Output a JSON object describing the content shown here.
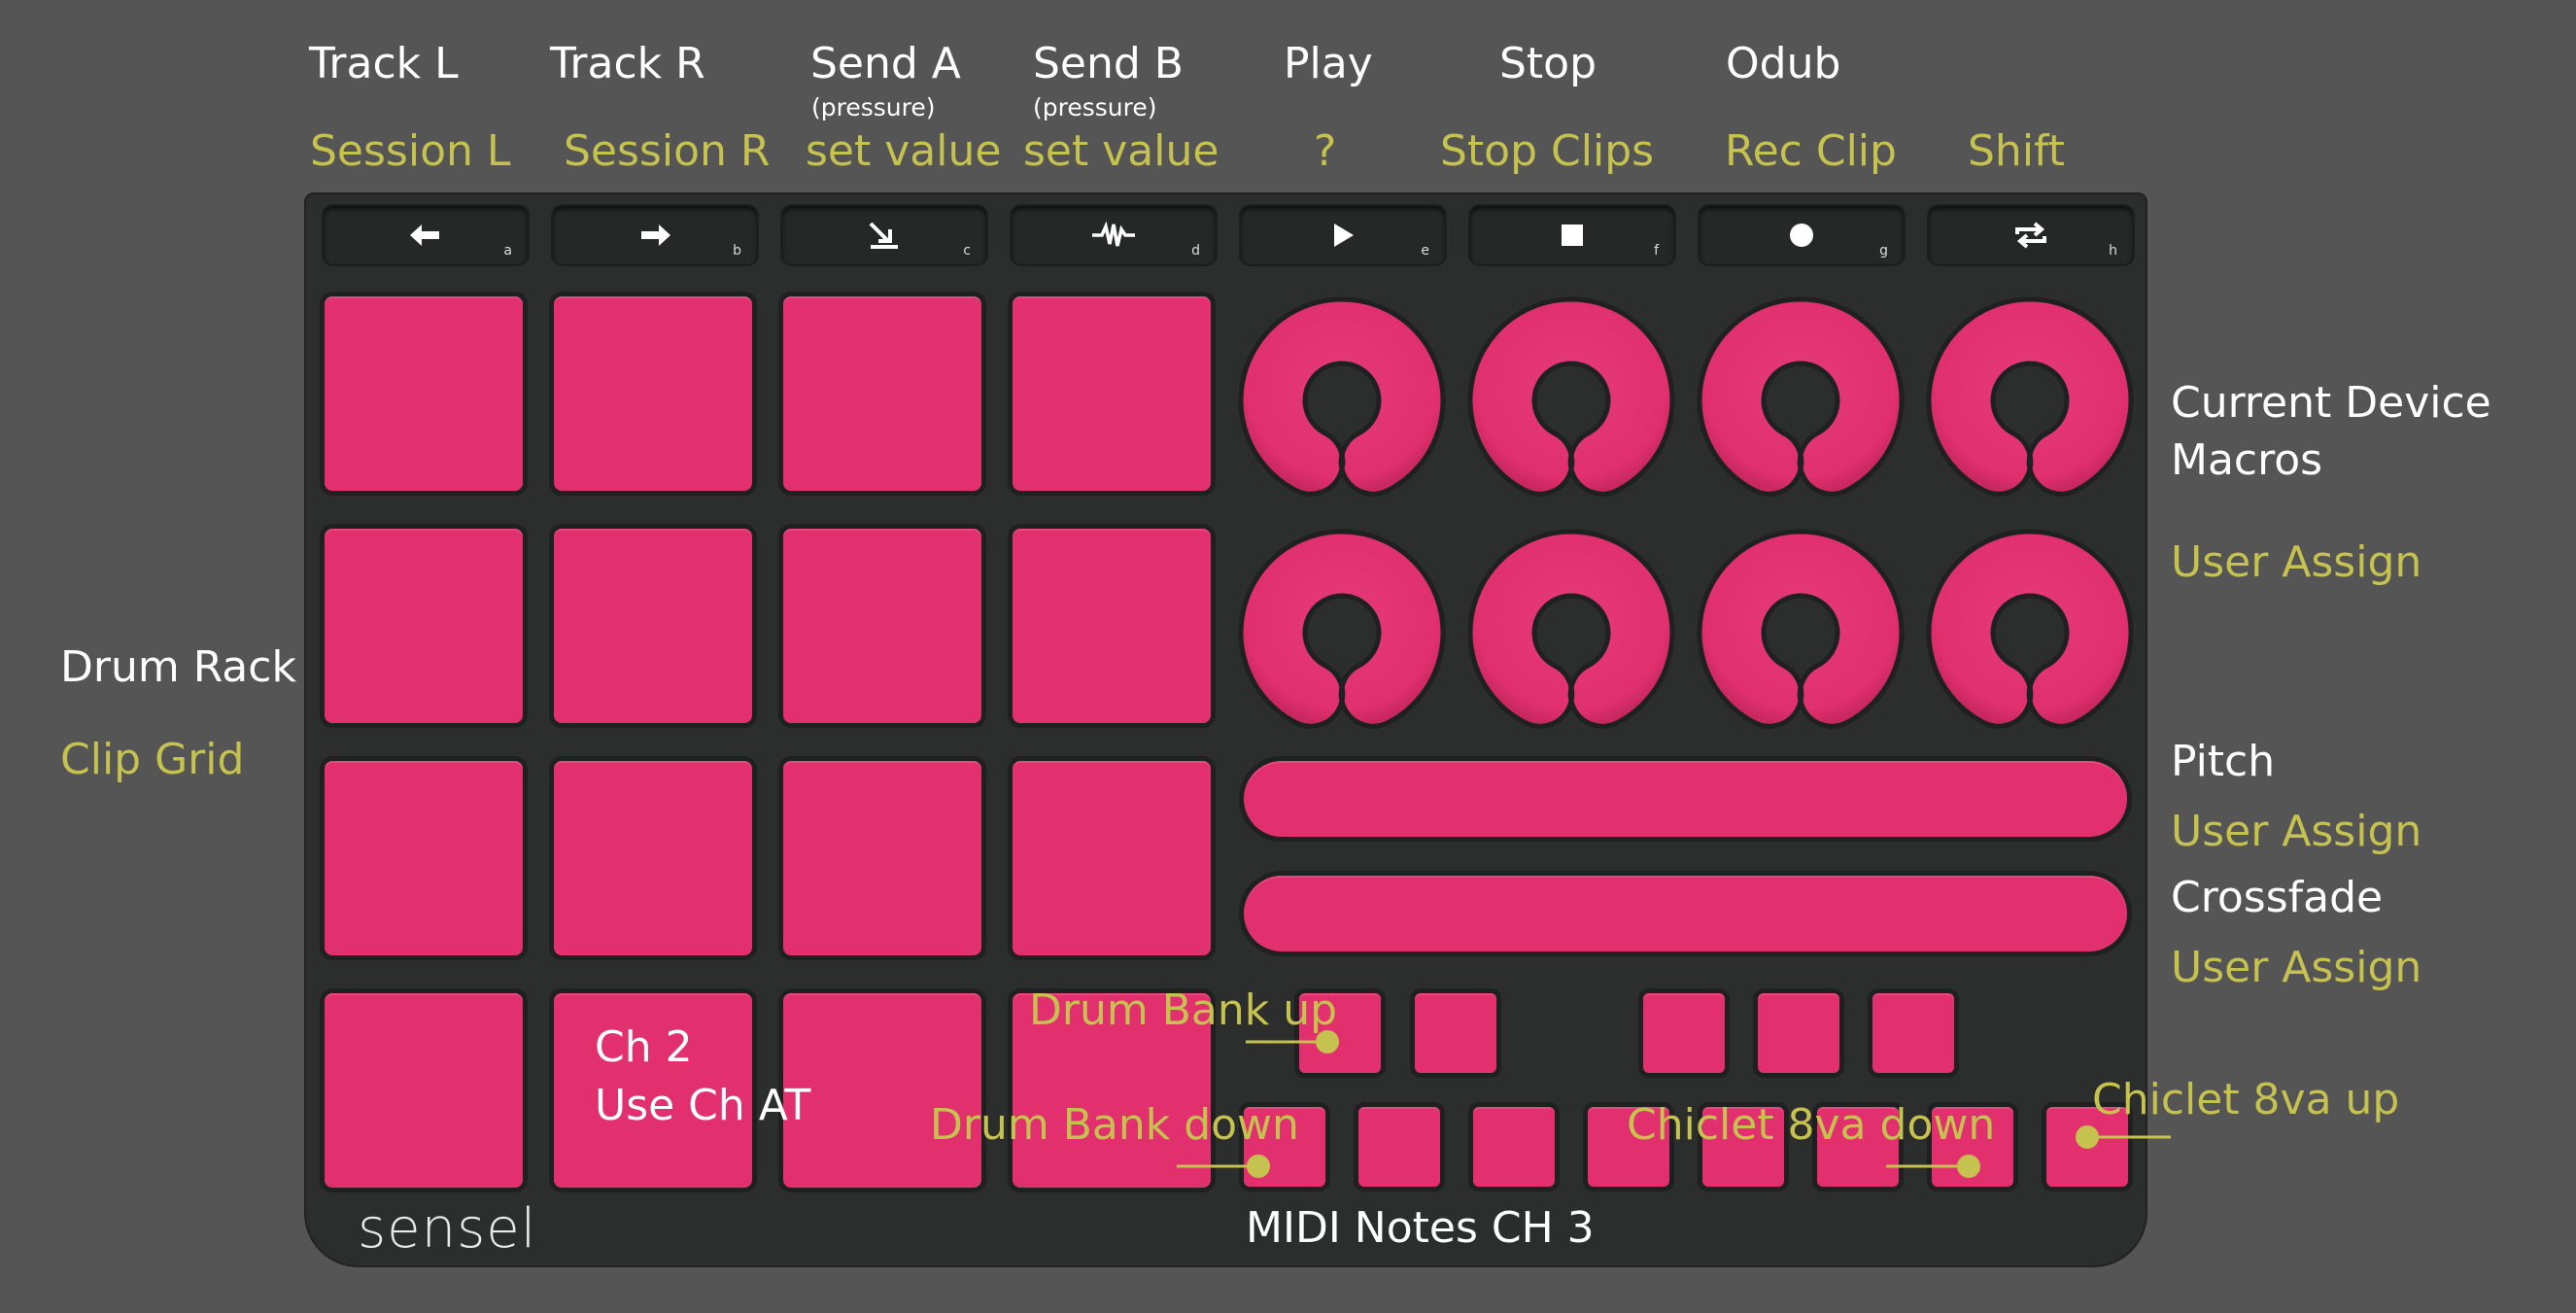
{
  "colors": {
    "background": "#555555",
    "device": "#2c2d2d",
    "pad": "#e2306f",
    "label_primary": "#ffffff",
    "label_alt": "#c6c24f"
  },
  "function_buttons": [
    {
      "icon": "arrow-left-icon",
      "key": "a"
    },
    {
      "icon": "arrow-right-icon",
      "key": "b"
    },
    {
      "icon": "send-icon",
      "key": "c"
    },
    {
      "icon": "waveform-icon",
      "key": "d"
    },
    {
      "icon": "play-icon",
      "key": "e"
    },
    {
      "icon": "stop-icon",
      "key": "f"
    },
    {
      "icon": "record-icon",
      "key": "g"
    },
    {
      "icon": "loop-icon",
      "key": "h"
    }
  ],
  "top_labels": {
    "primary": [
      "Track L",
      "Track R",
      "Send A",
      "Send B",
      "Play",
      "Stop",
      "Odub"
    ],
    "sublabels": [
      "(pressure)",
      "(pressure)"
    ],
    "alternate": [
      "Session L",
      "Session R",
      "set value",
      "set value",
      "?",
      "Stop Clips",
      "Rec Clip",
      "Shift"
    ]
  },
  "left_labels": {
    "primary": "Drum Rack",
    "alternate": "Clip Grid"
  },
  "right_labels": {
    "macros_line1": "Current Device",
    "macros_line2": "Macros",
    "macros_alt": "User Assign",
    "pitch": "Pitch",
    "pitch_alt": "User Assign",
    "crossfade": "Crossfade",
    "crossfade_alt": "User Assign"
  },
  "grid_labels": {
    "line1": "Ch 2",
    "line2": "Use Ch AT"
  },
  "annotations": {
    "drum_bank_up": "Drum Bank up",
    "drum_bank_down": "Drum Bank down",
    "chiclet_down": "Chiclet 8va down",
    "chiclet_up": "Chiclet 8va up"
  },
  "bottom_label": "MIDI Notes CH 3",
  "brand": "sensel"
}
